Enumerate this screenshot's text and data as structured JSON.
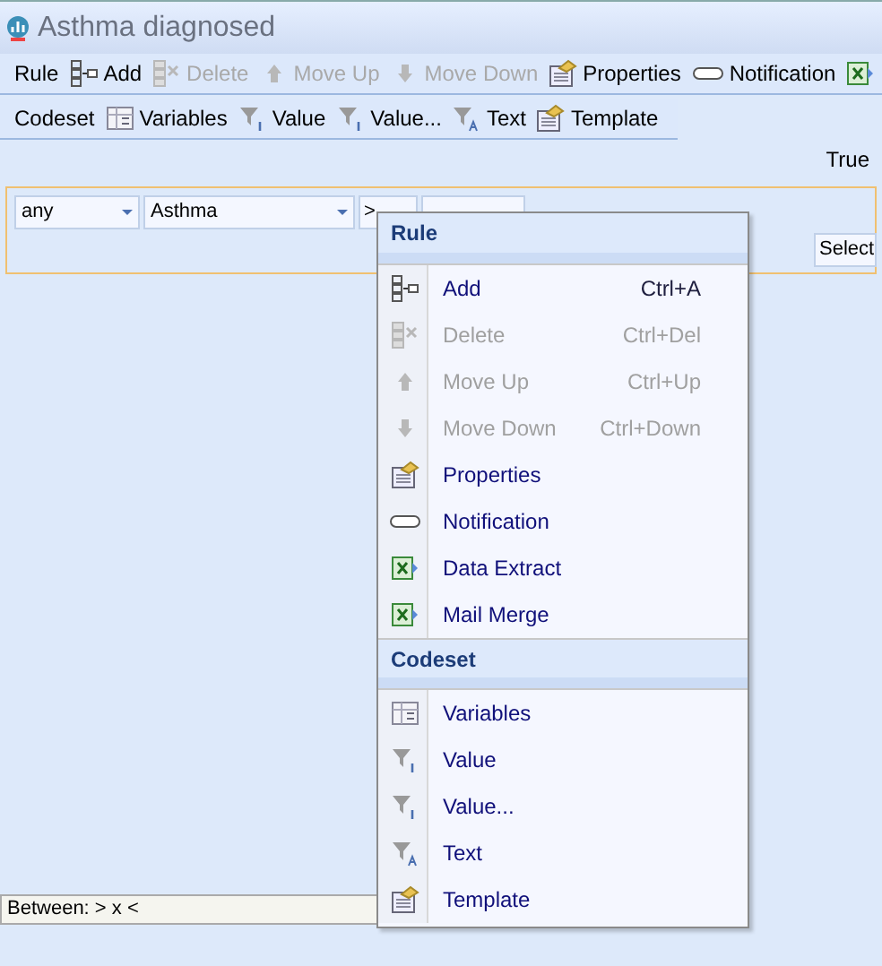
{
  "window": {
    "title": "Asthma diagnosed"
  },
  "toolbars": [
    {
      "label": "Rule",
      "items": [
        {
          "kind": "add",
          "label": "Add",
          "disabled": false
        },
        {
          "kind": "delete",
          "label": "Delete",
          "disabled": true
        },
        {
          "kind": "up",
          "label": "Move Up",
          "disabled": true
        },
        {
          "kind": "down",
          "label": "Move Down",
          "disabled": true
        },
        {
          "kind": "properties",
          "label": "Properties",
          "disabled": false
        },
        {
          "kind": "notification",
          "label": "Notification",
          "disabled": false
        },
        {
          "kind": "excel",
          "disabled": false
        }
      ]
    },
    {
      "label": "Codeset",
      "items": [
        {
          "kind": "variables",
          "label": "Variables",
          "disabled": false
        },
        {
          "kind": "value",
          "label": "Value",
          "disabled": false
        },
        {
          "kind": "value",
          "label": "Value...",
          "disabled": false
        },
        {
          "kind": "text",
          "label": "Text",
          "disabled": false
        },
        {
          "kind": "properties",
          "label": "Template",
          "disabled": false
        }
      ]
    }
  ],
  "result": "True",
  "rule": {
    "quantifier": "any",
    "codeset": "Asthma",
    "operator": ">",
    "select": "Select"
  },
  "status_field": {
    "value": "Between: > x <"
  },
  "context_menu": [
    {
      "header": "Rule",
      "items": [
        {
          "kind": "add",
          "label": "Add",
          "shortcut": "Ctrl+A",
          "disabled": false
        },
        {
          "kind": "delete",
          "label": "Delete",
          "shortcut": "Ctrl+Del",
          "disabled": true
        },
        {
          "kind": "up",
          "label": "Move Up",
          "shortcut": "Ctrl+Up",
          "disabled": true
        },
        {
          "kind": "down",
          "label": "Move Down",
          "shortcut": "Ctrl+Down",
          "disabled": true
        },
        {
          "kind": "properties",
          "label": "Properties",
          "disabled": false
        },
        {
          "kind": "notification",
          "label": "Notification",
          "disabled": false
        },
        {
          "kind": "excel",
          "label": "Data Extract",
          "disabled": false
        },
        {
          "kind": "excel",
          "label": "Mail Merge",
          "disabled": false
        }
      ]
    },
    {
      "header": "Codeset",
      "items": [
        {
          "kind": "variables",
          "label": "Variables",
          "disabled": false
        },
        {
          "kind": "value",
          "label": "Value",
          "disabled": false
        },
        {
          "kind": "value",
          "label": "Value...",
          "disabled": false
        },
        {
          "kind": "text",
          "label": "Text",
          "disabled": false
        },
        {
          "kind": "properties",
          "label": "Template",
          "disabled": false
        }
      ]
    }
  ]
}
